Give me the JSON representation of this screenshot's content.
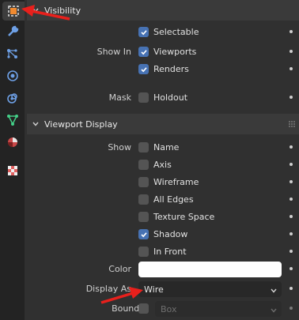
{
  "sidebar": {
    "tabs": [
      {
        "name": "object",
        "icon": "object-icon",
        "active": true
      },
      {
        "name": "modifiers",
        "icon": "wrench-icon"
      },
      {
        "name": "particles",
        "icon": "particles-icon"
      },
      {
        "name": "physics",
        "icon": "physics-icon"
      },
      {
        "name": "constraints",
        "icon": "constraints-icon"
      },
      {
        "name": "data",
        "icon": "vertex-data-icon"
      },
      {
        "name": "material",
        "icon": "material-icon"
      },
      {
        "name": "texture",
        "icon": "texture-checker-icon"
      }
    ]
  },
  "visibility": {
    "title": "Visibility",
    "selectable": {
      "label": "Selectable",
      "checked": true
    },
    "show_in_label": "Show In",
    "viewports": {
      "label": "Viewports",
      "checked": true
    },
    "renders": {
      "label": "Renders",
      "checked": true
    },
    "mask_label": "Mask",
    "holdout": {
      "label": "Holdout",
      "checked": false
    }
  },
  "viewport_display": {
    "title": "Viewport Display",
    "show_label": "Show",
    "name": {
      "label": "Name",
      "checked": false
    },
    "axis": {
      "label": "Axis",
      "checked": false
    },
    "wireframe": {
      "label": "Wireframe",
      "checked": false
    },
    "all_edges": {
      "label": "All Edges",
      "checked": false
    },
    "texture_space": {
      "label": "Texture Space",
      "checked": false
    },
    "shadow": {
      "label": "Shadow",
      "checked": true
    },
    "in_front": {
      "label": "In Front",
      "checked": false
    },
    "color_label": "Color",
    "color_value": "#ffffff",
    "display_as_label": "Display As",
    "display_as_value": "Wire",
    "bounds_label": "Bounds",
    "bounds_checked": false,
    "bounds_type": "Box"
  },
  "colors": {
    "accent": "#4772b3",
    "annotation_arrow": "#e8201c"
  }
}
